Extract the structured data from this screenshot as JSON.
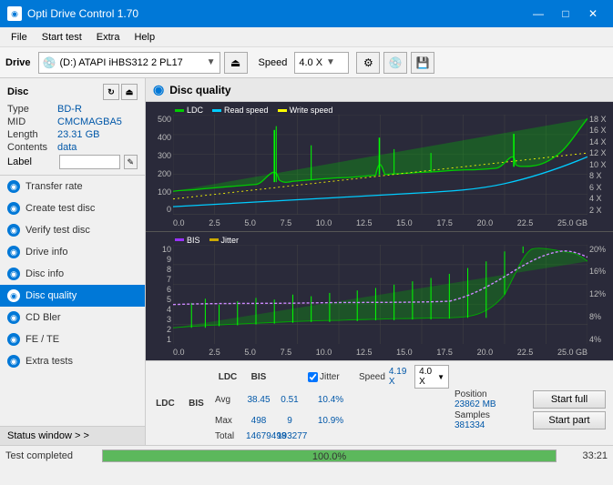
{
  "titleBar": {
    "title": "Opti Drive Control 1.70",
    "controls": [
      "—",
      "□",
      "✕"
    ]
  },
  "menuBar": {
    "items": [
      "File",
      "Start test",
      "Extra",
      "Help"
    ]
  },
  "toolbar": {
    "driveLabel": "Drive",
    "driveValue": "(D:)  ATAPI iHBS312  2 PL17",
    "speedLabel": "Speed",
    "speedValue": "4.0 X"
  },
  "sidebar": {
    "disc": {
      "header": "Disc",
      "fields": [
        {
          "label": "Type",
          "value": "BD-R"
        },
        {
          "label": "MID",
          "value": "CMCMAGBA5"
        },
        {
          "label": "Length",
          "value": "23.31 GB"
        },
        {
          "label": "Contents",
          "value": "data"
        },
        {
          "label": "Label",
          "value": ""
        }
      ]
    },
    "navItems": [
      {
        "label": "Transfer rate",
        "icon": "blue"
      },
      {
        "label": "Create test disc",
        "icon": "blue"
      },
      {
        "label": "Verify test disc",
        "icon": "blue"
      },
      {
        "label": "Drive info",
        "icon": "blue"
      },
      {
        "label": "Disc info",
        "icon": "blue"
      },
      {
        "label": "Disc quality",
        "icon": "green",
        "active": true
      },
      {
        "label": "CD Bler",
        "icon": "blue"
      },
      {
        "label": "FE / TE",
        "icon": "blue"
      },
      {
        "label": "Extra tests",
        "icon": "blue"
      }
    ],
    "statusWindow": "Status window > >"
  },
  "chart": {
    "title": "Disc quality",
    "topChart": {
      "legend": [
        "LDC",
        "Read speed",
        "Write speed"
      ],
      "legendColors": [
        "#00cc00",
        "#00ccff",
        "#ffff00"
      ],
      "yAxisLeft": [
        "500",
        "400",
        "300",
        "200",
        "100",
        "0"
      ],
      "yAxisRight": [
        "18 X",
        "16 X",
        "14 X",
        "12 X",
        "10 X",
        "8 X",
        "6 X",
        "4 X",
        "2 X"
      ],
      "xAxis": [
        "0.0",
        "2.5",
        "5.0",
        "7.5",
        "10.0",
        "12.5",
        "15.0",
        "17.5",
        "20.0",
        "22.5",
        "25.0 GB"
      ]
    },
    "bottomChart": {
      "legend": [
        "BIS",
        "Jitter"
      ],
      "legendColors": [
        "#8800ff",
        "#ccaa00"
      ],
      "yAxisLeft": [
        "10",
        "9",
        "8",
        "7",
        "6",
        "5",
        "4",
        "3",
        "2",
        "1"
      ],
      "yAxisRight": [
        "20%",
        "16%",
        "12%",
        "8%",
        "4%"
      ],
      "xAxis": [
        "0.0",
        "2.5",
        "5.0",
        "7.5",
        "10.0",
        "12.5",
        "15.0",
        "17.5",
        "20.0",
        "22.5",
        "25.0 GB"
      ]
    },
    "stats": {
      "headers": [
        "LDC",
        "BIS",
        "",
        "Jitter"
      ],
      "avg": {
        "ldc": "38.45",
        "bis": "0.51",
        "jitter": "10.4%"
      },
      "max": {
        "ldc": "498",
        "bis": "9",
        "jitter": "10.9%"
      },
      "total": {
        "ldc": "14679498",
        "bis": "193277",
        "jitter": ""
      },
      "speed": {
        "label": "Speed",
        "value": "4.19 X",
        "select": "4.0 X"
      },
      "position": {
        "label": "Position",
        "value": "23862 MB"
      },
      "samples": {
        "label": "Samples",
        "value": "381334"
      },
      "startFull": "Start full",
      "startPart": "Start part"
    }
  },
  "statusBar": {
    "text": "Test completed",
    "progress": 100,
    "progressText": "100.0%",
    "time": "33:21"
  }
}
